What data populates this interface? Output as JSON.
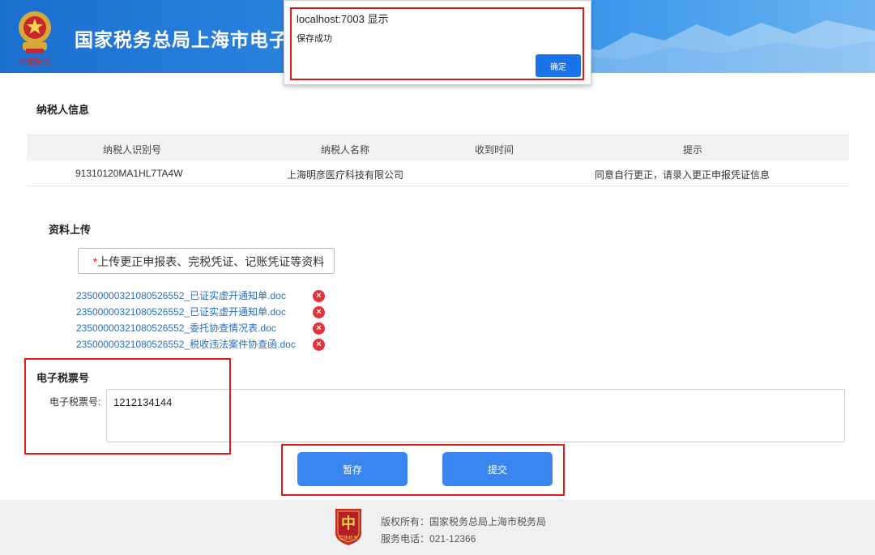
{
  "header": {
    "title": "国家税务总局上海市电子",
    "emblem_caption": "中国税务"
  },
  "dialog": {
    "origin": "localhost:7003 显示",
    "message": "保存成功",
    "ok_label": "确定"
  },
  "taxpayer": {
    "section_title": "纳税人信息",
    "columns": [
      "纳税人识别号",
      "纳税人名称",
      "收到时间",
      "提示"
    ],
    "row": {
      "id": "91310120MA1HL7TA4W",
      "name": "上海明彦医疗科技有限公司",
      "received_time": "",
      "hint": "同意自行更正，请录入更正申报凭证信息"
    }
  },
  "upload": {
    "section_title": "资料上传",
    "required_mark": "*",
    "button_label": "上传更正申报表、完税凭证、记账凭证等资料",
    "files": [
      "23500000321080526552_已证实虚开通知单.doc",
      "23500000321080526552_已证实虚开通知单.doc",
      "23500000321080526552_委托协查情况表.doc",
      "23500000321080526552_税收违法案件协查函.doc"
    ],
    "delete_icon": "x-circle-icon"
  },
  "ticket": {
    "section_title": "电子税票号",
    "label": "电子税票号:",
    "value": "1212134144"
  },
  "actions": {
    "save_label": "暂存",
    "submit_label": "提交"
  },
  "footer": {
    "copyright": "版权所有：国家税务总局上海市税务局",
    "phone": "服务电话：021-12366",
    "badge_text": "党政机关"
  },
  "colors": {
    "primary": "#3a86f0",
    "header": "#2d86e0",
    "highlight": "#e01b1b",
    "link": "#2a6ebb"
  }
}
